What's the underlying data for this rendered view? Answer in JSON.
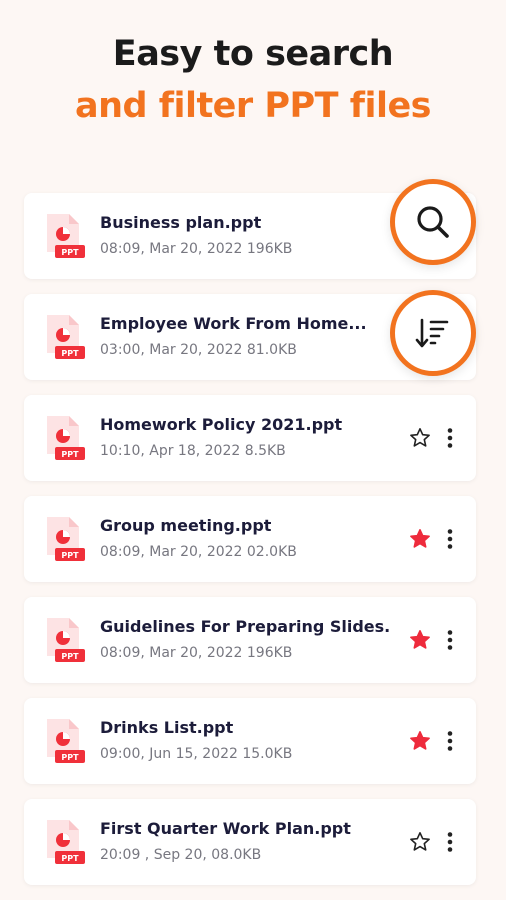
{
  "header": {
    "line1": "Easy to search",
    "line2": "and filter PPT files"
  },
  "colors": {
    "accent": "#f2731f",
    "file_icon": "#f0303a",
    "star_active": "#ee2b3c"
  },
  "actions": {
    "search_icon": "search-icon",
    "sort_icon": "sort-icon"
  },
  "files": [
    {
      "name": "Business plan.ppt",
      "meta": "08:09, Mar 20, 2022  196KB",
      "badge": "PPT",
      "starred": null
    },
    {
      "name": "Employee Work From Home...",
      "meta": "03:00, Mar 20, 2022  81.0KB",
      "badge": "PPT",
      "starred": null
    },
    {
      "name": "Homework Policy 2021.ppt",
      "meta": "10:10, Apr 18, 2022  8.5KB",
      "badge": "PPT",
      "starred": false
    },
    {
      "name": "Group meeting.ppt",
      "meta": "08:09, Mar 20, 2022  02.0KB",
      "badge": "PPT",
      "starred": true
    },
    {
      "name": "Guidelines For Preparing Slides...",
      "meta": "08:09, Mar 20, 2022  196KB",
      "badge": "PPT",
      "starred": true
    },
    {
      "name": "Drinks List.ppt",
      "meta": "09:00, Jun 15, 2022  15.0KB",
      "badge": "PPT",
      "starred": true
    },
    {
      "name": "First Quarter Work Plan.ppt",
      "meta": "20:09 , Sep 20,  08.0KB",
      "badge": "PPT",
      "starred": false
    }
  ]
}
